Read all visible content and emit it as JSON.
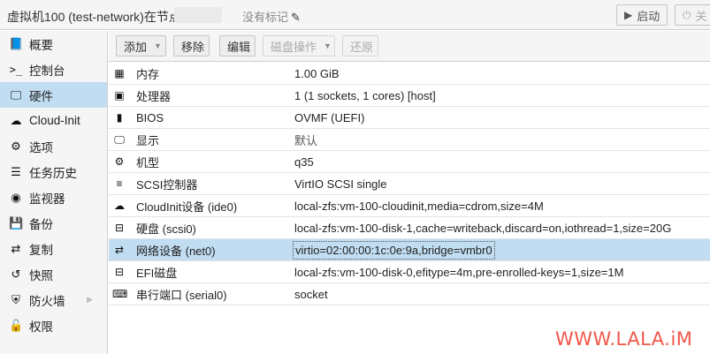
{
  "header": {
    "title": "虚拟机100 (test-network)在节点'",
    "tags_label": "没有标记",
    "start_label": "启动",
    "shutdown_label": "关"
  },
  "sidebar": {
    "items": [
      {
        "label": "概要",
        "icon": "book-icon"
      },
      {
        "label": "控制台",
        "icon": "terminal-icon"
      },
      {
        "label": "硬件",
        "icon": "desktop-icon"
      },
      {
        "label": "Cloud-Init",
        "icon": "cloud-icon"
      },
      {
        "label": "选项",
        "icon": "gear-icon"
      },
      {
        "label": "任务历史",
        "icon": "list-icon"
      },
      {
        "label": "监视器",
        "icon": "eye-icon"
      },
      {
        "label": "备份",
        "icon": "floppy-icon"
      },
      {
        "label": "复制",
        "icon": "retweet-icon"
      },
      {
        "label": "快照",
        "icon": "history-icon"
      },
      {
        "label": "防火墙",
        "icon": "shield-icon"
      },
      {
        "label": "权限",
        "icon": "unlock-icon"
      }
    ],
    "active_index": 2
  },
  "toolbar": {
    "add_label": "添加",
    "remove_label": "移除",
    "edit_label": "编辑",
    "disk_action_label": "磁盘操作",
    "revert_label": "还原"
  },
  "hardware": {
    "rows": [
      {
        "key": "内存",
        "value": "1.00 GiB",
        "icon": "memory-icon"
      },
      {
        "key": "处理器",
        "value": "1 (1 sockets, 1 cores) [host]",
        "icon": "cpu-icon"
      },
      {
        "key": "BIOS",
        "value": "OVMF (UEFI)",
        "icon": "microchip-icon"
      },
      {
        "key": "显示",
        "value": "默认",
        "icon": "desktop-icon"
      },
      {
        "key": "机型",
        "value": "q35",
        "icon": "cogs-icon"
      },
      {
        "key": "SCSI控制器",
        "value": "VirtIO SCSI single",
        "icon": "database-icon"
      },
      {
        "key": "CloudInit设备 (ide0)",
        "value": "local-zfs:vm-100-cloudinit,media=cdrom,size=4M",
        "icon": "cloud-icon"
      },
      {
        "key": "硬盘 (scsi0)",
        "value": "local-zfs:vm-100-disk-1,cache=writeback,discard=on,iothread=1,size=20G",
        "icon": "hdd-icon"
      },
      {
        "key": "网络设备 (net0)",
        "value": "virtio=02:00:00:1c:0e:9a,bridge=vmbr0",
        "icon": "exchange-icon"
      },
      {
        "key": "EFI磁盘",
        "value": "local-zfs:vm-100-disk-0,efitype=4m,pre-enrolled-keys=1,size=1M",
        "icon": "hdd-icon"
      },
      {
        "key": "串行端口 (serial0)",
        "value": "socket",
        "icon": "keyboard-icon"
      }
    ],
    "selected_index": 8
  },
  "watermark": "WWW.LALA.iM",
  "colors": {
    "selection": "#c1ddf1",
    "watermark": "#f0574a"
  }
}
